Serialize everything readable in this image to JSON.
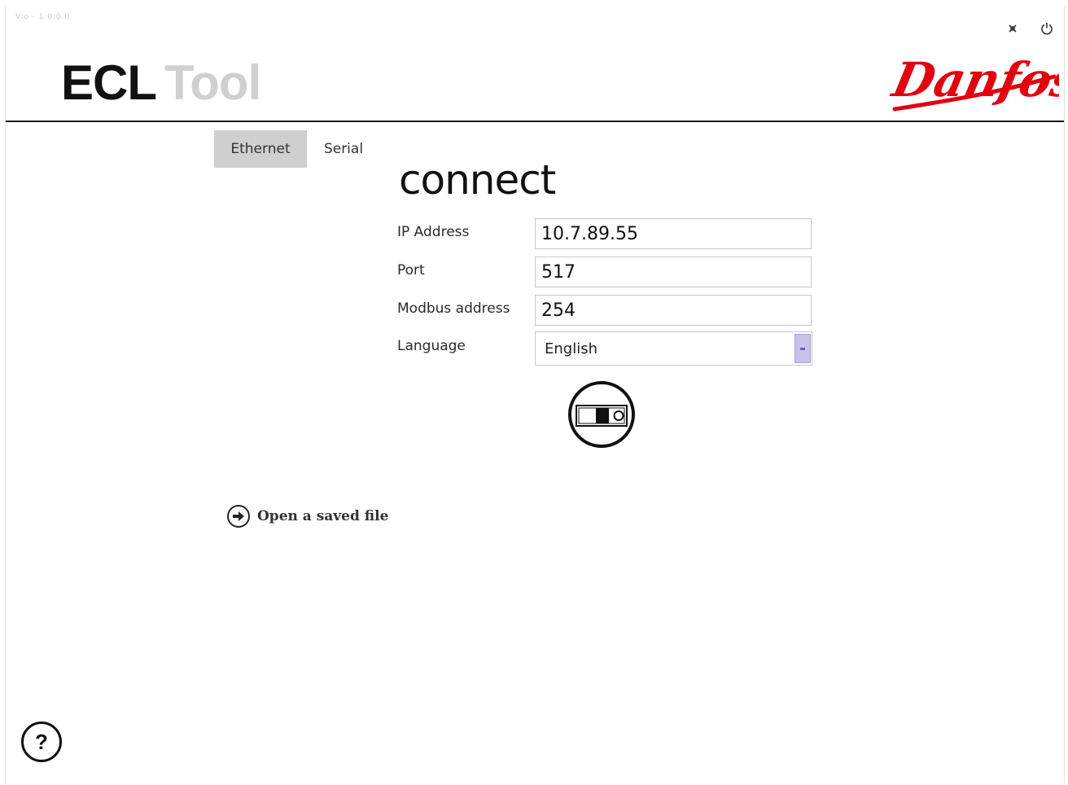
{
  "window": {
    "titlebar_text": "Vio · 1.0.0.0",
    "pin_icon": "pin-icon",
    "power_icon": "power-icon"
  },
  "header": {
    "title_part1": "ECL",
    "title_part2": "Tool",
    "brand": "Danfoss",
    "brand_color": "#e2000f"
  },
  "tabs": [
    {
      "label": "Ethernet",
      "active": true
    },
    {
      "label": "Serial",
      "active": false
    }
  ],
  "form": {
    "heading": "connect",
    "ip_label": "IP Address",
    "ip_value": "10.7.89.55",
    "port_label": "Port",
    "port_value": "517",
    "modbus_label": "Modbus address",
    "modbus_value": "254",
    "language_label": "Language",
    "language_value": "English"
  },
  "actions": {
    "connect_icon": "controller-connect-icon",
    "open_file_label": "Open a saved file",
    "open_file_icon": "arrow-circle-right-icon",
    "help_icon": "help-icon"
  }
}
